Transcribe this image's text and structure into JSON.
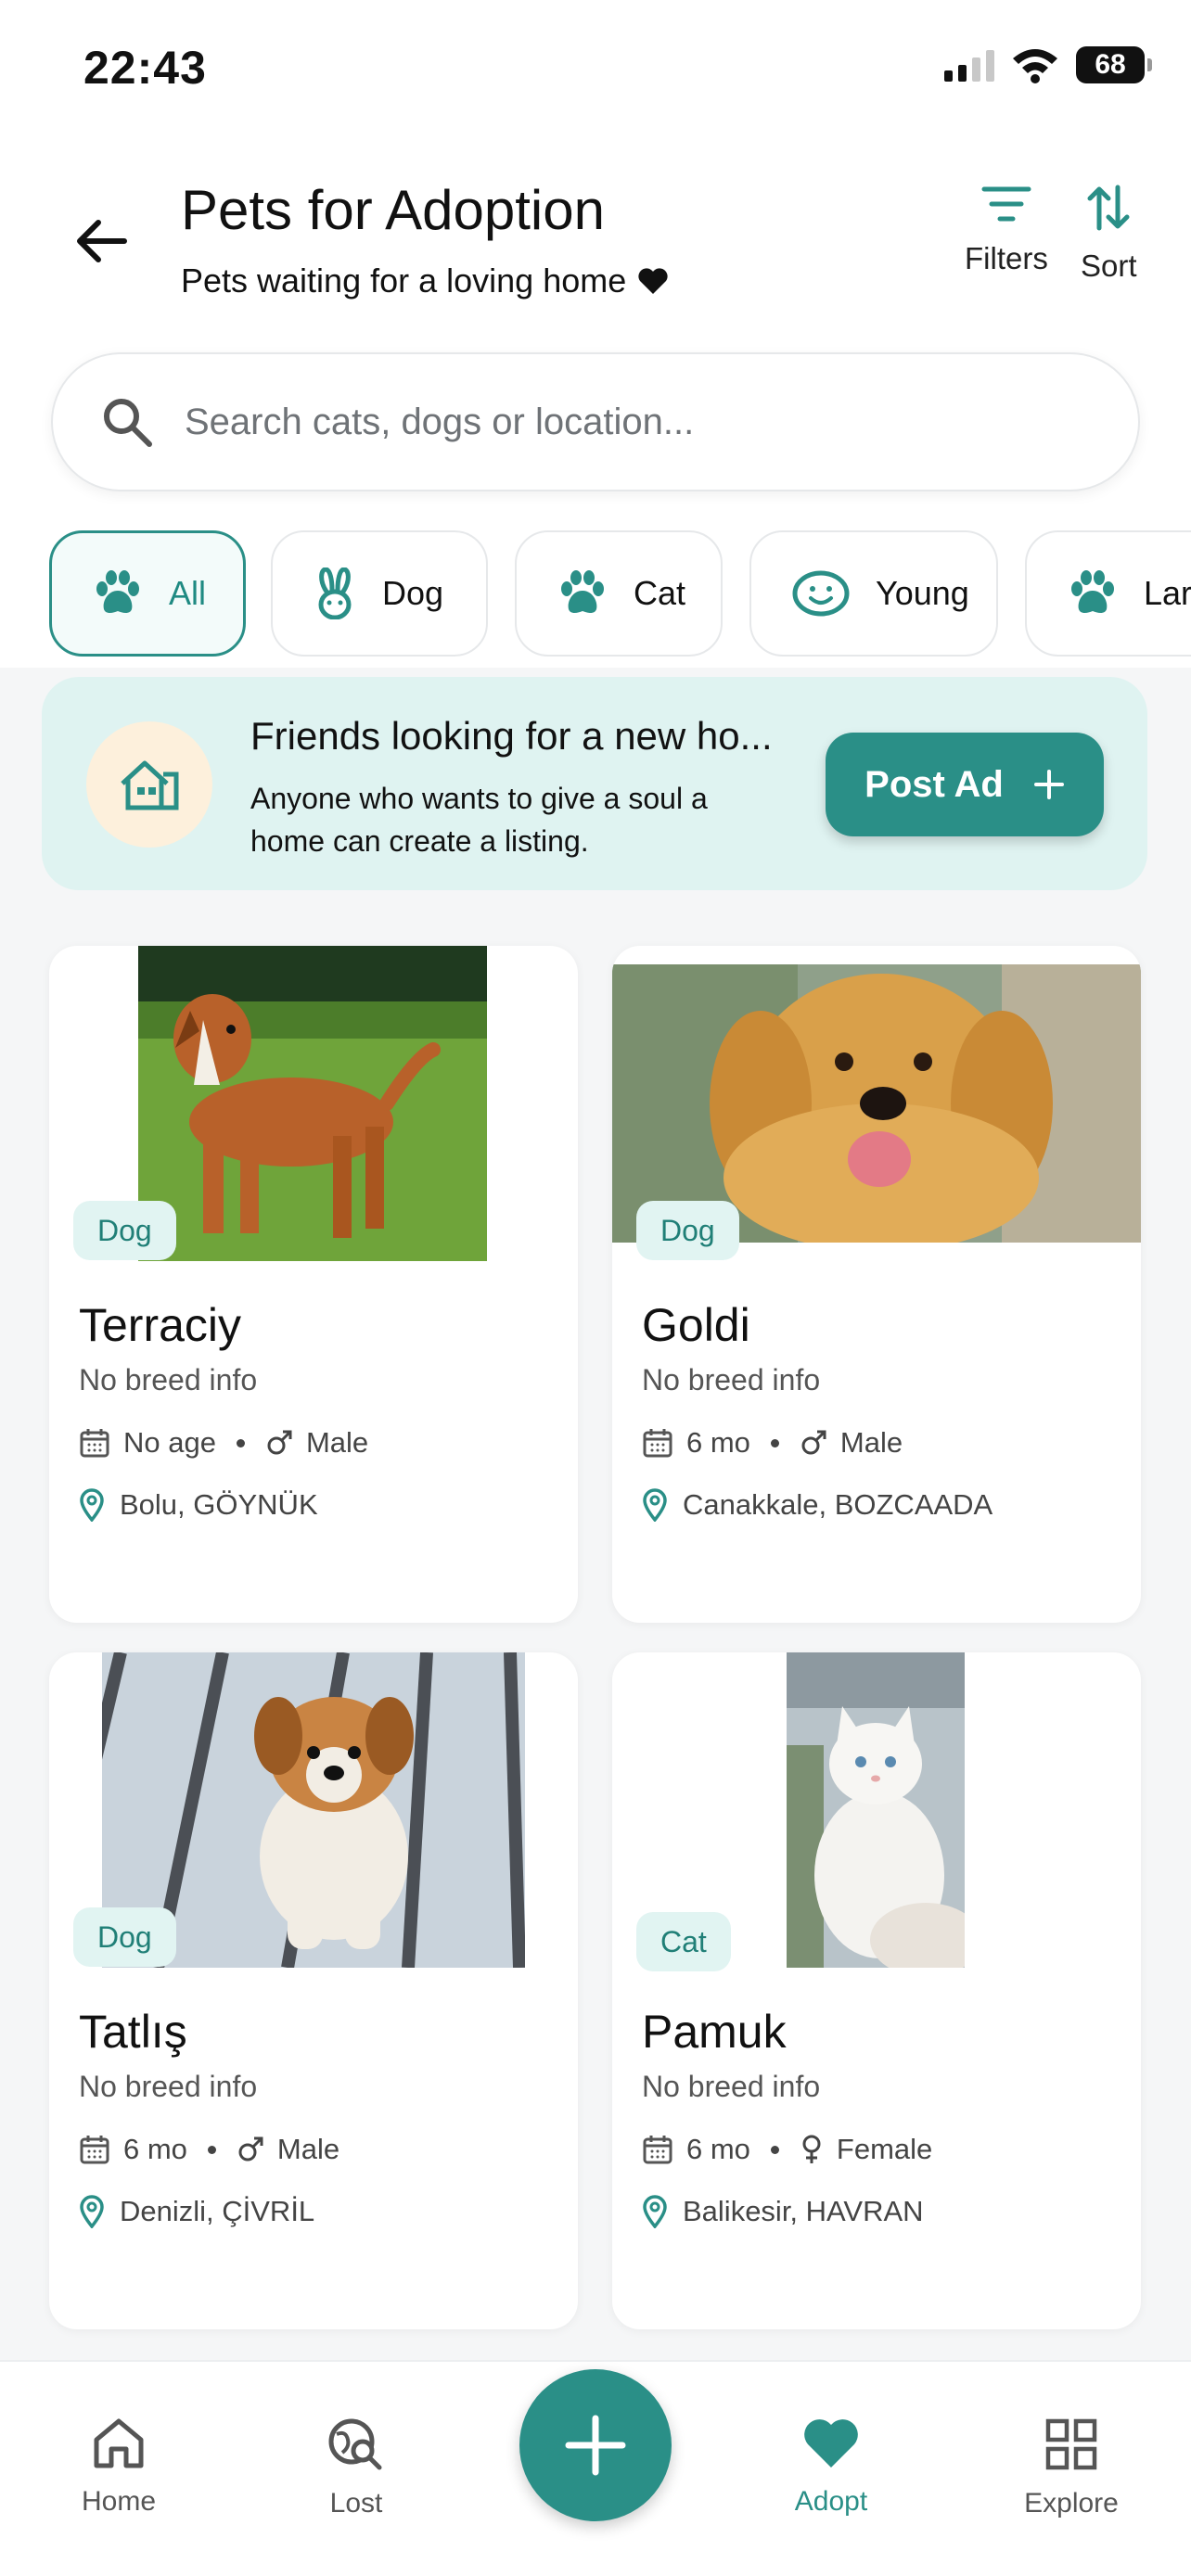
{
  "status_bar": {
    "time": "22:43",
    "battery": "68"
  },
  "header": {
    "title": "Pets for Adoption",
    "subtitle": "Pets waiting for a loving home",
    "filters_label": "Filters",
    "sort_label": "Sort"
  },
  "search": {
    "placeholder": "Search cats, dogs or location..."
  },
  "chips": [
    {
      "label": "All",
      "icon": "paw-icon",
      "active": true
    },
    {
      "label": "Dog",
      "icon": "bunny-icon"
    },
    {
      "label": "Cat",
      "icon": "paw-icon"
    },
    {
      "label": "Young",
      "icon": "smile-icon"
    },
    {
      "label": "Lar",
      "icon": "paw-icon"
    }
  ],
  "banner": {
    "title": "Friends looking for a new ho...",
    "text": "Anyone who wants to give a soul a home can create a listing.",
    "button_label": "Post Ad"
  },
  "pets": [
    {
      "name": "Terraciy",
      "type": "Dog",
      "breed": "No breed info",
      "age": "No age",
      "sex": "Male",
      "location": "Bolu, GÖYNÜK"
    },
    {
      "name": "Goldi",
      "type": "Dog",
      "breed": "No breed info",
      "age": "6 mo",
      "sex": "Male",
      "location": "Canakkale, BOZCAADA"
    },
    {
      "name": "Tatlış",
      "type": "Dog",
      "breed": "No breed info",
      "age": "6 mo",
      "sex": "Male",
      "location": "Denizli, ÇİVRİL"
    },
    {
      "name": "Pamuk",
      "type": "Cat",
      "breed": "No breed info",
      "age": "6 mo",
      "sex": "Female",
      "location": "Balikesir, HAVRAN"
    }
  ],
  "bottom_nav": {
    "items": [
      {
        "label": "Home",
        "icon": "home-icon"
      },
      {
        "label": "Lost",
        "icon": "lost-search-icon"
      },
      {
        "label": "Adopt",
        "icon": "heart-icon",
        "active": true
      },
      {
        "label": "Explore",
        "icon": "grid-icon"
      }
    ]
  },
  "colors": {
    "accent": "#2a8f87",
    "banner_bg": "#dff3f1",
    "tag_bg": "#e1f4f2"
  }
}
